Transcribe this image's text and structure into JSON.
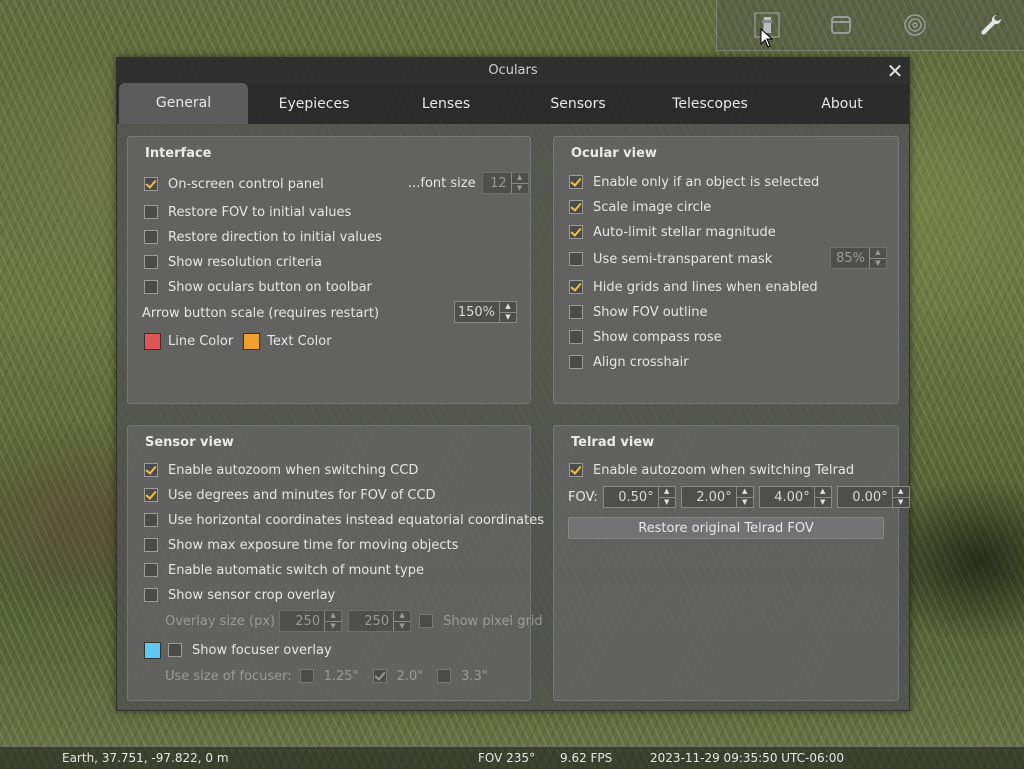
{
  "dialog": {
    "title": "Oculars",
    "close_glyph": "✕",
    "tabs": [
      "General",
      "Eyepieces",
      "Lenses",
      "Sensors",
      "Telescopes",
      "About"
    ],
    "active_tab": "General"
  },
  "interface": {
    "title": "Interface",
    "on_screen_control_panel": "On-screen control panel",
    "font_size_label": "...font size",
    "font_size_value": "12",
    "restore_fov": "Restore FOV to initial values",
    "restore_direction": "Restore direction to initial values",
    "show_resolution": "Show resolution criteria",
    "show_button_toolbar": "Show oculars button on toolbar",
    "arrow_scale_label": "Arrow button scale (requires restart)",
    "arrow_scale_value": "150%",
    "line_color_label": "Line Color",
    "text_color_label": "Text Color",
    "line_color": "#e05555",
    "text_color": "#f0a030"
  },
  "ocular_view": {
    "title": "Ocular view",
    "enable_only_selected": "Enable only if an object is selected",
    "scale_image_circle": "Scale image circle",
    "auto_limit": "Auto-limit stellar magnitude",
    "semi_transparent": "Use semi-transparent mask",
    "semi_transparent_value": "85%",
    "hide_grids": "Hide grids and lines when enabled",
    "show_fov_outline": "Show FOV outline",
    "show_compass": "Show compass rose",
    "align_crosshair": "Align crosshair"
  },
  "sensor_view": {
    "title": "Sensor view",
    "autozoom_ccd": "Enable autozoom when switching CCD",
    "degrees_minutes": "Use degrees and minutes for FOV of CCD",
    "horizontal_coords": "Use horizontal coordinates instead equatorial coordinates",
    "max_exposure": "Show max exposure time for moving objects",
    "auto_mount_switch": "Enable automatic switch of mount type",
    "crop_overlay": "Show sensor crop overlay",
    "overlay_size_label": "Overlay size (px)",
    "overlay_w": "250",
    "overlay_h": "250",
    "show_pixel_grid": "Show pixel grid",
    "focuser_overlay": "Show focuser overlay",
    "focuser_color": "#5ec8f0",
    "use_size_label": "Use size of focuser:",
    "size_125": "1.25\"",
    "size_20": "2.0\"",
    "size_33": "3.3\""
  },
  "telrad_view": {
    "title": "Telrad view",
    "autozoom_telrad": "Enable autozoom when switching Telrad",
    "fov_label": "FOV:",
    "fov1": "0.50°",
    "fov2": "2.00°",
    "fov3": "4.00°",
    "fov4": "0.00°",
    "restore_button": "Restore original Telrad FOV"
  },
  "status": {
    "location": "Earth, 37.751, -97.822, 0 m",
    "fov": "FOV 235°",
    "fps": "9.62 FPS",
    "datetime": "2023-11-29 09:35:50 UTC-06:00"
  }
}
